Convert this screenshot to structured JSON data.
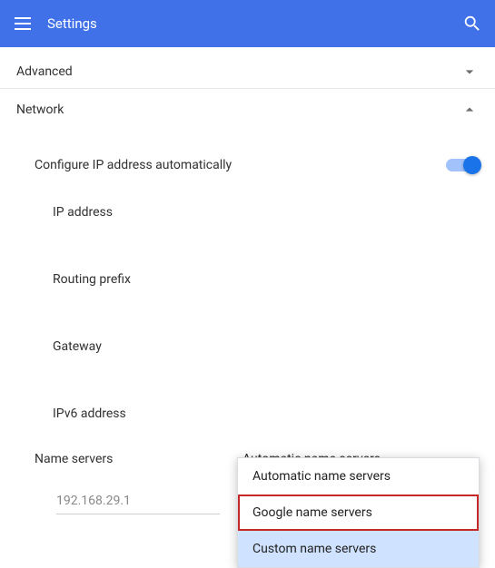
{
  "header": {
    "title": "Settings"
  },
  "sections": {
    "advanced": {
      "label": "Advanced",
      "expanded": false
    },
    "network": {
      "label": "Network",
      "expanded": true
    }
  },
  "network": {
    "configure_auto": {
      "label": "Configure IP address automatically",
      "value": true
    },
    "fields": {
      "ip": "IP address",
      "routing_prefix": "Routing prefix",
      "gateway": "Gateway",
      "ipv6": "IPv6 address"
    },
    "name_servers": {
      "label": "Name servers",
      "selected": "Automatic name servers",
      "options": [
        "Automatic name servers",
        "Google name servers",
        "Custom name servers"
      ],
      "input_value": "192.168.29.1"
    }
  }
}
